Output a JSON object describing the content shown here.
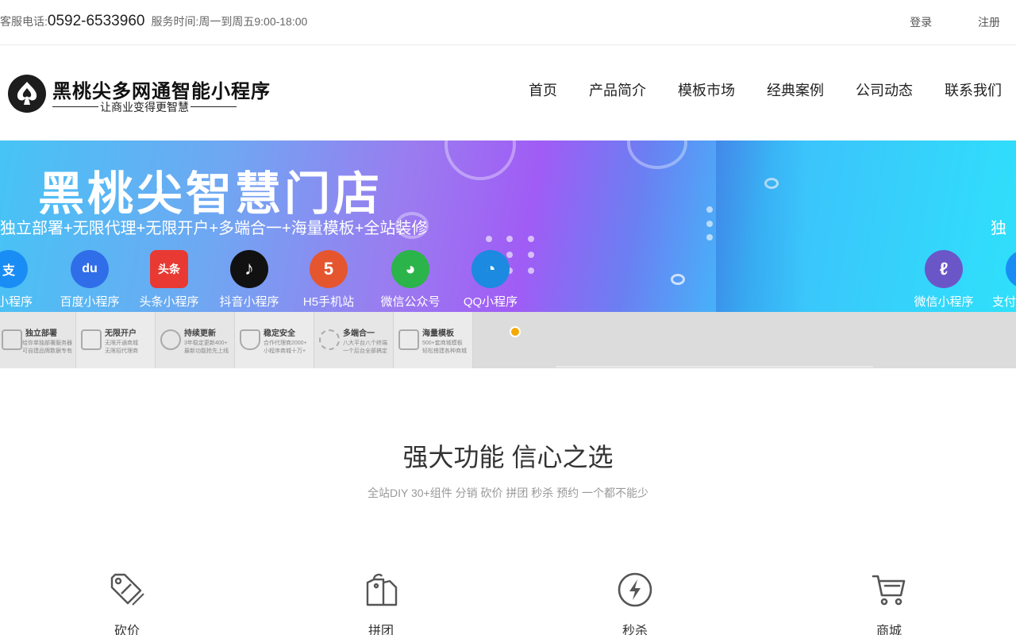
{
  "topbar": {
    "service_label": "客服电话:",
    "phone": "0592-6533960",
    "hours": "服务时间:周一到周五9:00-18:00",
    "login": "登录",
    "register": "注册"
  },
  "logo": {
    "title": "黑桃尖多网通智能小程序",
    "slogan": "让商业变得更智慧"
  },
  "nav": [
    "首页",
    "产品简介",
    "模板市场",
    "经典案例",
    "公司动态",
    "联系我们"
  ],
  "banner": {
    "title": "黑桃尖智慧门店",
    "subtitle": "独立部署+无限代理+无限开户+多端合一+海量模板+全站装修",
    "subtitle_cut": "独",
    "platforms": [
      {
        "label": "宝小程序",
        "glyph": "支",
        "color": "#1a8df5",
        "icon": "alipay-icon"
      },
      {
        "label": "百度小程序",
        "glyph": "du",
        "color": "#2f6ee8",
        "icon": "baidu-icon"
      },
      {
        "label": "头条小程序",
        "glyph": "头条",
        "color": "#e83a33",
        "icon": "toutiao-icon"
      },
      {
        "label": "抖音小程序",
        "glyph": "♪",
        "color": "#111111",
        "icon": "douyin-icon"
      },
      {
        "label": "H5手机站",
        "glyph": "5",
        "color": "#e5562f",
        "icon": "html5-icon"
      },
      {
        "label": "微信公众号",
        "glyph": "◕",
        "color": "#2bb44a",
        "icon": "wechat-icon"
      },
      {
        "label": "QQ小程序",
        "glyph": "◔",
        "color": "#1b8ae0",
        "icon": "qq-icon"
      },
      {
        "label": "微信小程序",
        "glyph": "ℓ",
        "color": "#6b56c8",
        "icon": "miniprogram-icon"
      },
      {
        "label": "支付",
        "glyph": "支",
        "color": "#1a8df5",
        "icon": "alipay-icon"
      }
    ],
    "features": [
      {
        "title": "独立部署",
        "desc1": "给你单独部署服务器",
        "desc2": "可自建品牌数据专有"
      },
      {
        "title": "无限开户",
        "desc1": "无限开通商城",
        "desc2": "无限招代理商"
      },
      {
        "title": "持续更新",
        "desc1": "3年稳定更新400+",
        "desc2": "最新功能抢先上线"
      },
      {
        "title": "稳定安全",
        "desc1": "合作代理商2000+",
        "desc2": "小程序商城十万+"
      },
      {
        "title": "多端合一",
        "desc1": "八大平台八个终端",
        "desc2": "一个后台全部搞定"
      },
      {
        "title": "海量模板",
        "desc1": "500+套商城模板",
        "desc2": "轻松搭建各种商城"
      }
    ]
  },
  "section": {
    "title": "强大功能 信心之选",
    "subtitle": "全站DIY 30+组件 分销 砍价 拼团 秒杀 预约 一个都不能少",
    "functions": [
      {
        "label": "砍价",
        "icon": "price-tag-icon"
      },
      {
        "label": "拼团",
        "icon": "group-tag-icon"
      },
      {
        "label": "秒杀",
        "icon": "lightning-icon"
      },
      {
        "label": "商城",
        "icon": "cart-icon"
      }
    ]
  },
  "colors": {
    "accent_dot": "#f5a800",
    "banner_purple": "#a05cf5",
    "banner_cyan": "#2fe0fb"
  }
}
